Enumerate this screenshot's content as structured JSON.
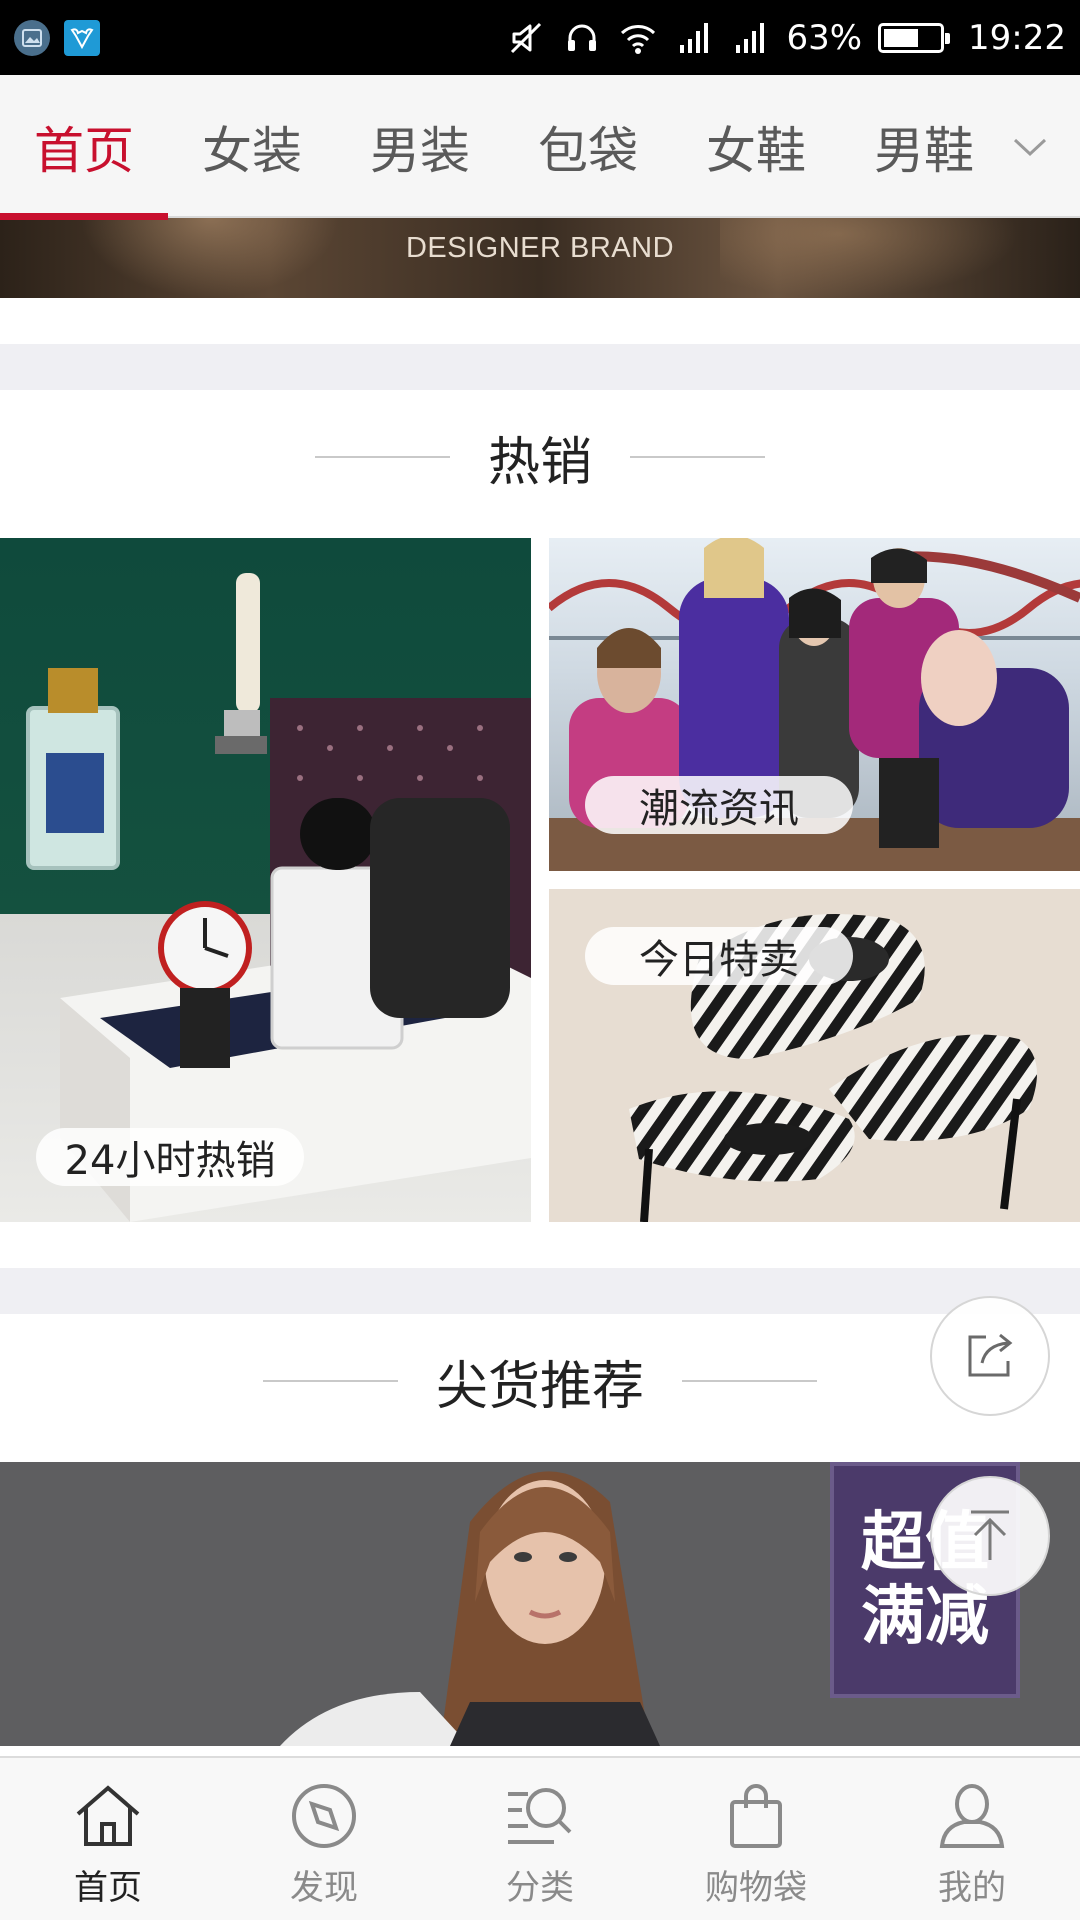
{
  "status_bar": {
    "battery": "63%",
    "battery_level": 0.63,
    "time": "19:22",
    "left_icons": [
      "gallery-icon",
      "app-icon"
    ],
    "right_icons": [
      "mute-icon",
      "headset-icon",
      "wifi-icon",
      "signal-icon",
      "signal-icon",
      "battery-icon"
    ]
  },
  "category_tabs": {
    "items": [
      {
        "label": "首页",
        "active": true
      },
      {
        "label": "女装",
        "active": false
      },
      {
        "label": "男装",
        "active": false
      },
      {
        "label": "包袋",
        "active": false
      },
      {
        "label": "女鞋",
        "active": false
      },
      {
        "label": "男鞋",
        "active": false
      }
    ],
    "expand_icon": "chevron-down-icon",
    "active_color": "#c8102e"
  },
  "banner": {
    "caption": "DESIGNER BRAND"
  },
  "hot_section": {
    "title": "热销",
    "tiles": [
      {
        "label": "24小时热销",
        "image": "perfume-gift-box"
      },
      {
        "label": "潮流资讯",
        "image": "fashion-group-photo"
      },
      {
        "label": "今日特卖",
        "image": "striped-heels"
      }
    ]
  },
  "recommend_section": {
    "title": "尖货推荐",
    "promo_badge": [
      "超值",
      "满减"
    ]
  },
  "floating_buttons": {
    "share": "share-icon",
    "back_to_top": "arrow-up-icon"
  },
  "bottom_nav": {
    "items": [
      {
        "label": "首页",
        "icon": "home-icon",
        "active": true
      },
      {
        "label": "发现",
        "icon": "compass-icon",
        "active": false
      },
      {
        "label": "分类",
        "icon": "category-search-icon",
        "active": false
      },
      {
        "label": "购物袋",
        "icon": "shopping-bag-icon",
        "active": false
      },
      {
        "label": "我的",
        "icon": "user-icon",
        "active": false
      }
    ]
  }
}
